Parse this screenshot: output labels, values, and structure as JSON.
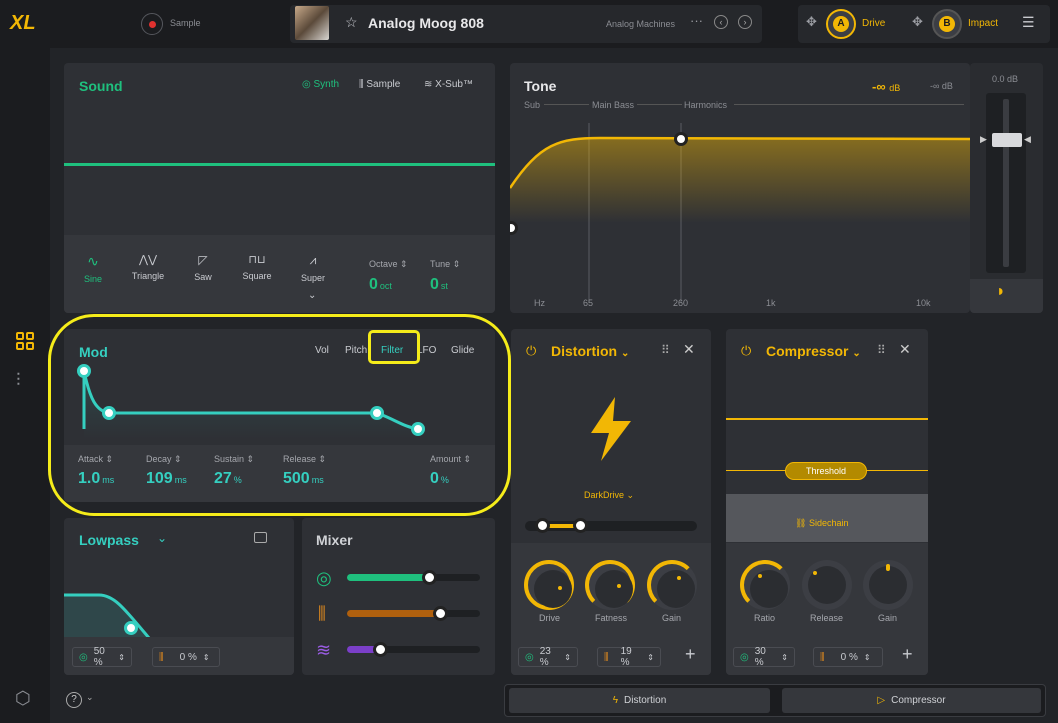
{
  "top": {
    "logo": "XL",
    "sample_label": "Sample",
    "preset_name": "Analog Moog 808",
    "preset_category": "Analog Machines",
    "more": "···",
    "macro_a_letter": "A",
    "macro_a_label": "Drive",
    "macro_b_letter": "B",
    "macro_b_label": "Impact"
  },
  "sound": {
    "title": "Sound",
    "tabs": [
      "Synth",
      "Sample",
      "X-Sub™"
    ],
    "waves": [
      {
        "label": "Sine",
        "symbol": "∿"
      },
      {
        "label": "Triangle",
        "symbol": "⋀⋁"
      },
      {
        "label": "Saw",
        "symbol": "◸"
      },
      {
        "label": "Square",
        "symbol": "⊓⊔"
      },
      {
        "label": "Super",
        "symbol": "⩘"
      }
    ],
    "octave_label": "Octave",
    "octave_value": "0",
    "octave_unit": "oct",
    "tune_label": "Tune",
    "tune_value": "0",
    "tune_unit": "st"
  },
  "tone": {
    "title": "Tone",
    "level": "-∞",
    "level_unit": "dB",
    "level2": "-∞ dB",
    "band_labels": [
      "Sub",
      "Main Bass",
      "Harmonics"
    ],
    "freq_labels": [
      "Hz",
      "65",
      "260",
      "1k",
      "10k"
    ],
    "meter_label": "0.0 dB"
  },
  "mod": {
    "title": "Mod",
    "tabs": [
      "Vol",
      "Pitch",
      "Filter",
      "LFO",
      "Glide"
    ],
    "params": [
      {
        "label": "Attack",
        "value": "1.0",
        "unit": "ms"
      },
      {
        "label": "Decay",
        "value": "109",
        "unit": "ms"
      },
      {
        "label": "Sustain",
        "value": "27",
        "unit": "%"
      },
      {
        "label": "Release",
        "value": "500",
        "unit": "ms"
      }
    ],
    "amount_label": "Amount",
    "amount_value": "0",
    "amount_unit": "%"
  },
  "lowpass": {
    "title": "Lowpass",
    "chip1": "50 %",
    "chip2": "0 %"
  },
  "mixer": {
    "title": "Mixer",
    "levels": [
      0.62,
      0.7,
      0.25
    ]
  },
  "distortion": {
    "title": "Distortion",
    "type": "DarkDrive",
    "knobs": [
      "Drive",
      "Fatness",
      "Gain"
    ],
    "chip1": "23 %",
    "chip2": "19 %",
    "add": "+"
  },
  "compressor": {
    "title": "Compressor",
    "threshold": "Threshold",
    "sidechain": "Sidechain",
    "knobs": [
      "Ratio",
      "Release",
      "Gain"
    ],
    "chip1": "30 %",
    "chip2": "0 %",
    "add": "+"
  },
  "chain": {
    "slot1": "Distortion",
    "slot2": "Compressor"
  },
  "colors": {
    "accent": "#f2b705",
    "green": "#1fc07e",
    "teal": "#35cfc0",
    "highlight": "#f5ec1a"
  }
}
